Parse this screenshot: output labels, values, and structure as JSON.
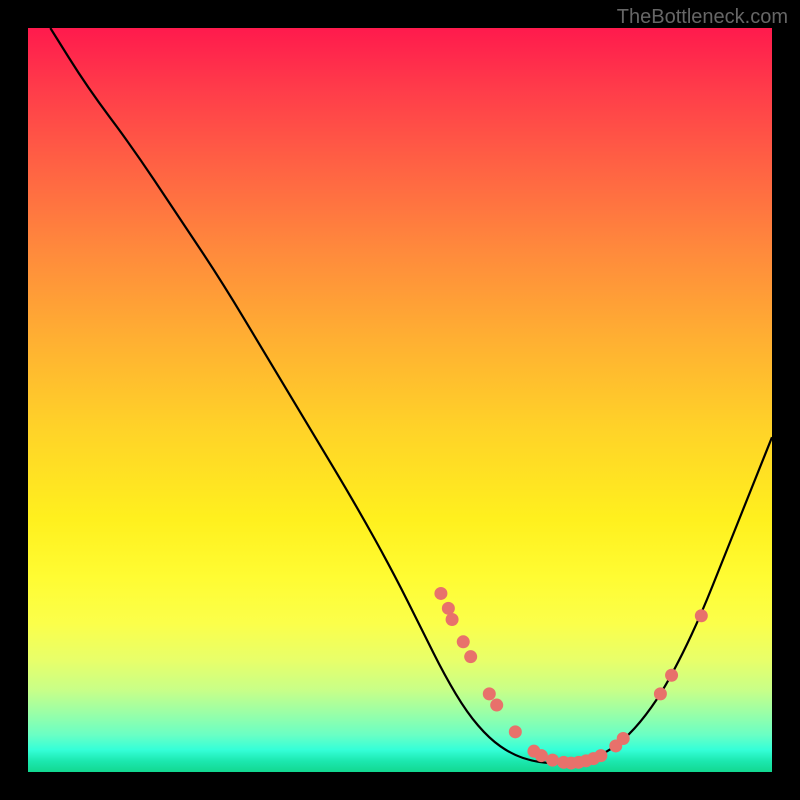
{
  "watermark": "TheBottleneck.com",
  "chart_data": {
    "type": "line",
    "title": "",
    "xlabel": "",
    "ylabel": "",
    "ylim": [
      0,
      100
    ],
    "xlim": [
      0,
      100
    ],
    "curve_points": [
      {
        "x": 3,
        "y": 100
      },
      {
        "x": 8,
        "y": 92
      },
      {
        "x": 14,
        "y": 84
      },
      {
        "x": 20,
        "y": 75
      },
      {
        "x": 26,
        "y": 66
      },
      {
        "x": 32,
        "y": 56
      },
      {
        "x": 38,
        "y": 46
      },
      {
        "x": 44,
        "y": 36
      },
      {
        "x": 49,
        "y": 27
      },
      {
        "x": 53,
        "y": 19
      },
      {
        "x": 56,
        "y": 13
      },
      {
        "x": 59,
        "y": 8
      },
      {
        "x": 62,
        "y": 4.5
      },
      {
        "x": 65,
        "y": 2.4
      },
      {
        "x": 68,
        "y": 1.4
      },
      {
        "x": 71,
        "y": 1.1
      },
      {
        "x": 74,
        "y": 1.3
      },
      {
        "x": 77,
        "y": 2.2
      },
      {
        "x": 80,
        "y": 4.2
      },
      {
        "x": 83,
        "y": 7.5
      },
      {
        "x": 86,
        "y": 12
      },
      {
        "x": 90,
        "y": 20
      },
      {
        "x": 94,
        "y": 30
      },
      {
        "x": 98,
        "y": 40
      },
      {
        "x": 100,
        "y": 45
      }
    ],
    "markers": [
      {
        "x": 55.5,
        "y": 24
      },
      {
        "x": 56.5,
        "y": 22
      },
      {
        "x": 57.0,
        "y": 20.5
      },
      {
        "x": 58.5,
        "y": 17.5
      },
      {
        "x": 59.5,
        "y": 15.5
      },
      {
        "x": 62.0,
        "y": 10.5
      },
      {
        "x": 63.0,
        "y": 9.0
      },
      {
        "x": 65.5,
        "y": 5.4
      },
      {
        "x": 68.0,
        "y": 2.8
      },
      {
        "x": 69.0,
        "y": 2.2
      },
      {
        "x": 70.5,
        "y": 1.6
      },
      {
        "x": 72.0,
        "y": 1.3
      },
      {
        "x": 73.0,
        "y": 1.2
      },
      {
        "x": 74.0,
        "y": 1.3
      },
      {
        "x": 75.0,
        "y": 1.5
      },
      {
        "x": 76.0,
        "y": 1.8
      },
      {
        "x": 77.0,
        "y": 2.2
      },
      {
        "x": 79.0,
        "y": 3.5
      },
      {
        "x": 80.0,
        "y": 4.5
      },
      {
        "x": 85.0,
        "y": 10.5
      },
      {
        "x": 86.5,
        "y": 13.0
      },
      {
        "x": 90.5,
        "y": 21.0
      }
    ],
    "marker_color": "#e8716b",
    "curve_color": "#000000",
    "gradient": [
      "#ff1a4d",
      "#ffd328",
      "#fff01e",
      "#35ffd8",
      "#12d890"
    ]
  }
}
